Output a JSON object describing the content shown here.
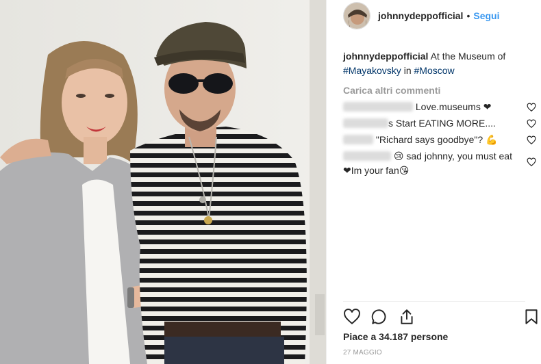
{
  "post": {
    "username": "johnnydeppofficial",
    "follow_label": "Segui",
    "separator": "•",
    "caption": {
      "username": "johnnydeppofficial",
      "text": "At the Museum of",
      "hashtag1": "#Mayakovsky",
      "in_word": "in",
      "hashtag2": "#Moscow"
    },
    "load_more_label": "Carica altri commenti",
    "comments": [
      {
        "text": "Love.museums ❤"
      },
      {
        "text": "s Start EATING MORE...."
      },
      {
        "text": "\"Richard says goodbye\"? 💪"
      },
      {
        "text": "😢 sad johnny, you must eat❤Im your fan😘"
      }
    ],
    "likes_label": "Piace a",
    "likes_count": "34.187",
    "likes_suffix": "persone",
    "date": "27 MAGGIO"
  },
  "icons": {
    "like": "heart-icon",
    "comment": "comment-bubble-icon",
    "share": "share-icon",
    "save": "bookmark-icon",
    "comment_like": "small-heart-icon"
  },
  "colors": {
    "link_blue": "#3897f0",
    "hashtag": "#003569",
    "muted": "#999999",
    "text": "#262626"
  }
}
